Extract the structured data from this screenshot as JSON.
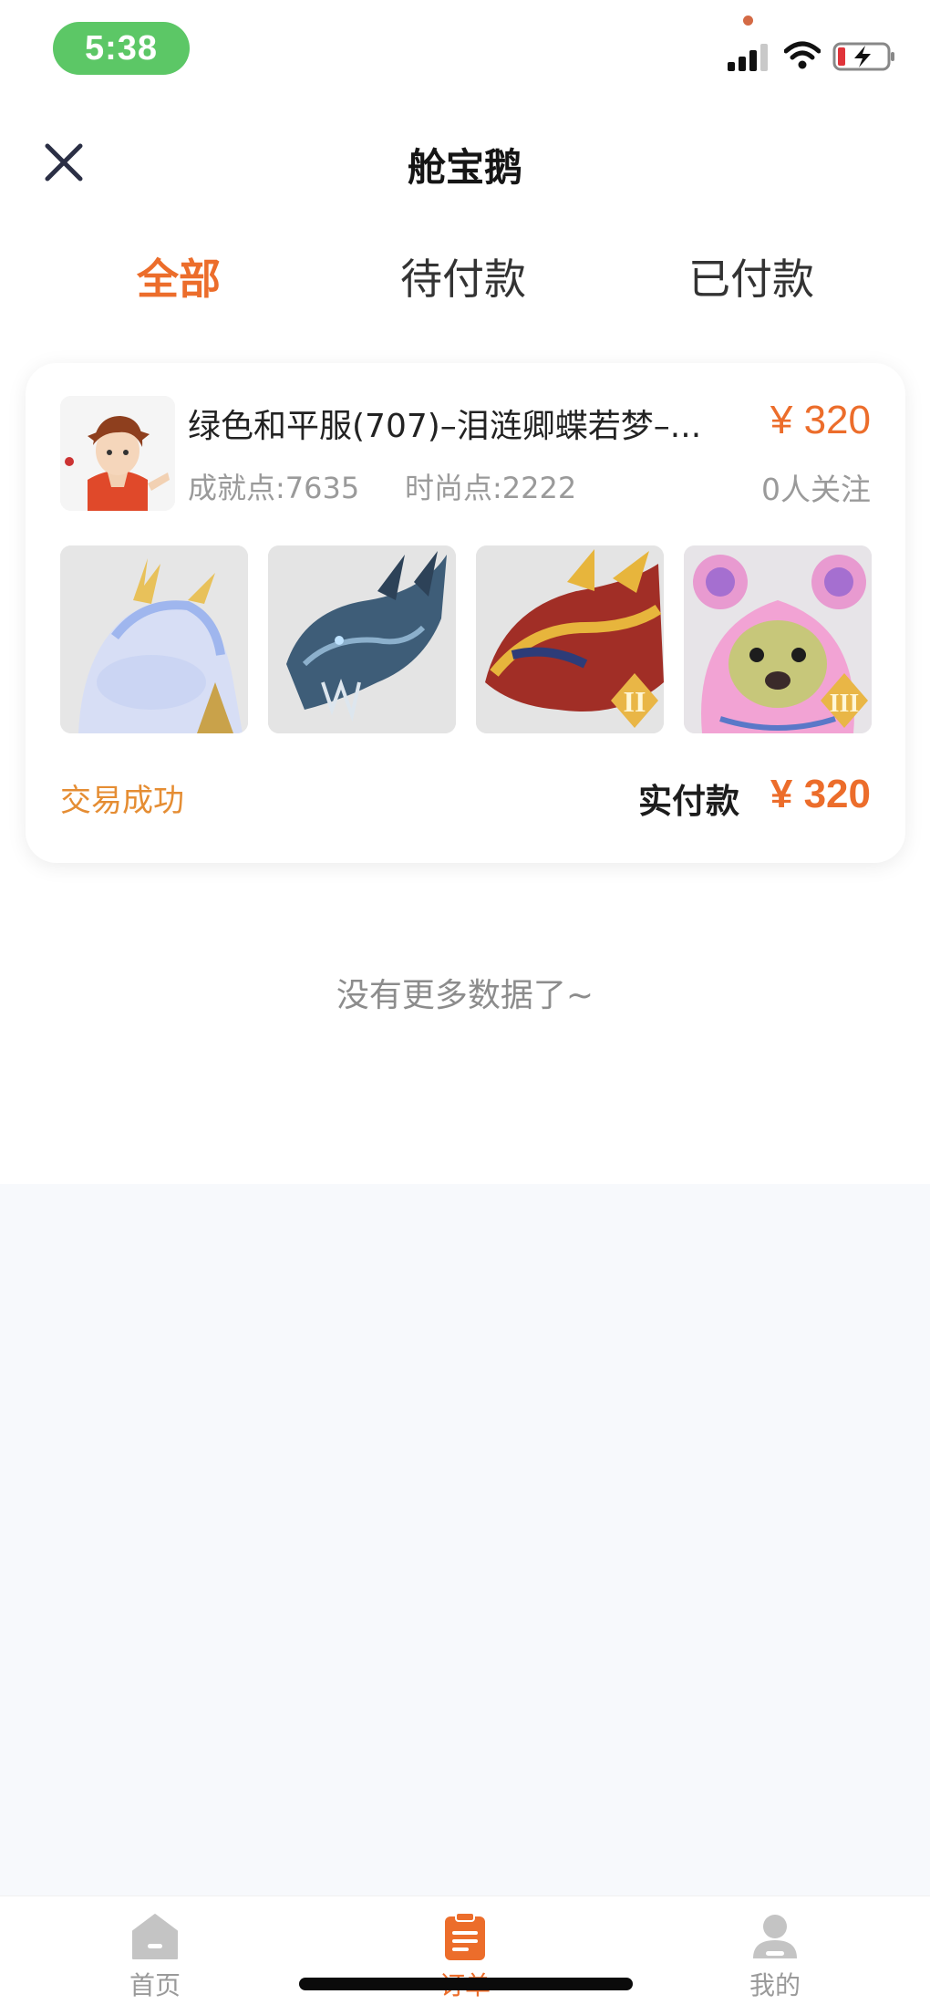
{
  "status_bar": {
    "time": "5:38"
  },
  "nav": {
    "title": "舱宝鹅",
    "close_icon": "close-icon"
  },
  "tabs": [
    {
      "label": "全部",
      "active": true
    },
    {
      "label": "待付款",
      "active": false
    },
    {
      "label": "已付款",
      "active": false
    }
  ],
  "order": {
    "title": "绿色和平服(707)–泪涟卿蝶若梦–...",
    "achievement": "成就点:7635",
    "fashion": "时尚点:2222",
    "price": "¥ 320",
    "followers": "0人关注",
    "thumbnails": [
      "lightning-horse-mount",
      "blue-dragon-mount",
      "golden-dragon-mount",
      "pink-bear-avatar"
    ],
    "badges": [
      "II",
      "III"
    ],
    "trade_status": "交易成功",
    "paid_label": "实付款",
    "paid_amount": "¥ 320"
  },
  "list_footer": "没有更多数据了~",
  "tab_bar": [
    {
      "label": "首页",
      "icon": "home-icon",
      "active": false
    },
    {
      "label": "订单",
      "icon": "order-icon",
      "active": true
    },
    {
      "label": "我的",
      "icon": "profile-icon",
      "active": false
    }
  ],
  "colors": {
    "accent": "#ec6d2b",
    "success": "#e58d33",
    "time_pill": "#5cc766",
    "page_bg_lower": "#f7f9fc"
  }
}
